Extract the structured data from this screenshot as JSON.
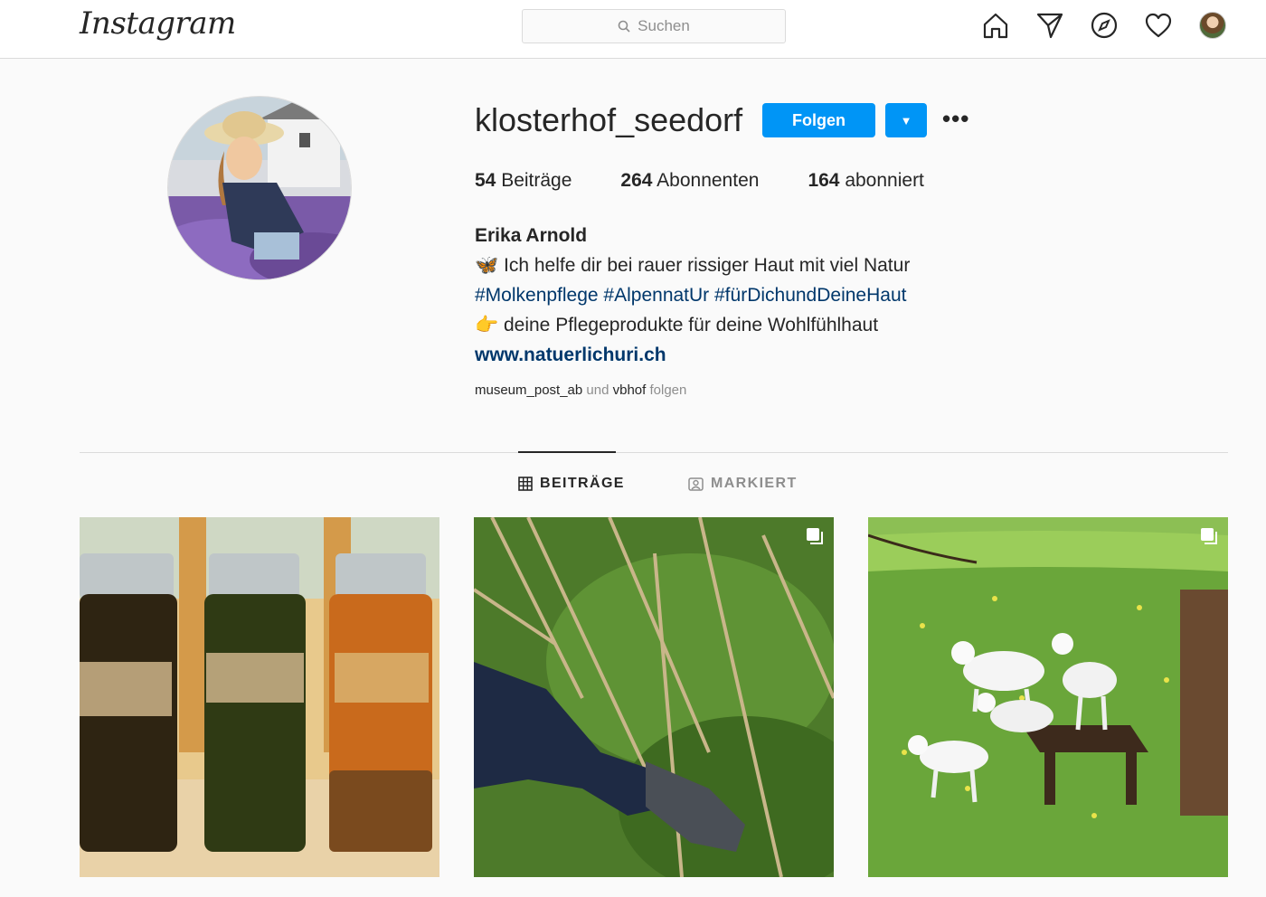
{
  "topbar": {
    "logo": "Instagram",
    "search_placeholder": "Suchen",
    "icons": [
      "home-icon",
      "direct-icon",
      "explore-icon",
      "activity-icon",
      "profile-avatar"
    ]
  },
  "profile": {
    "username": "klosterhof_seedorf",
    "follow_label": "Folgen",
    "more_label": "•••",
    "stats": [
      {
        "count": "54",
        "label": "Beiträge"
      },
      {
        "count": "264",
        "label": "Abonnenten"
      },
      {
        "count": "164",
        "label": "abonniert"
      }
    ],
    "full_name": "Erika Arnold",
    "bio_line1": "🦋 Ich helfe dir bei rauer rissiger Haut mit viel Natur",
    "bio_hashtags": "#Molkenpflege #AlpennatUr #fürDichundDeineHaut",
    "bio_line3": "👉 deine Pflegeprodukte für deine Wohlfühlhaut",
    "website": "www.natuerlichuri.ch",
    "followed_by": {
      "account1": "museum_post_ab",
      "conj": "und",
      "account2": "vbhof",
      "suffix": "folgen"
    }
  },
  "tabs": [
    {
      "label": "BEITRÄGE",
      "active": true
    },
    {
      "label": "MARKIERT",
      "active": false
    }
  ],
  "posts": [
    {
      "subject": "herb tincture jars",
      "carousel": false
    },
    {
      "subject": "gloved hand in nettles",
      "carousel": true
    },
    {
      "subject": "goats on meadow",
      "carousel": true
    }
  ],
  "colors": {
    "accent": "#0095f6",
    "link": "#00376b",
    "muted": "#8e8e8e"
  }
}
